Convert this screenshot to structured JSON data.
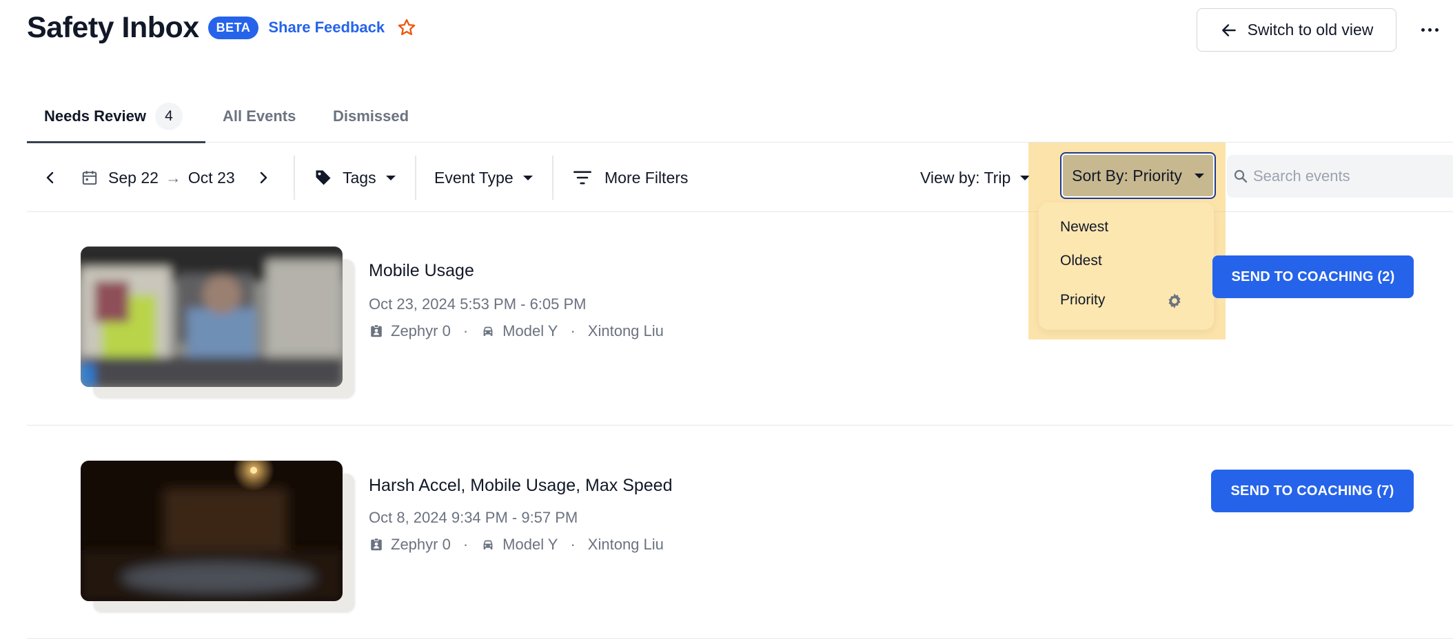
{
  "header": {
    "title": "Safety Inbox",
    "badge": "BETA",
    "feedback_link": "Share Feedback",
    "switch_button": "Switch to old view"
  },
  "tabs": [
    {
      "label": "Needs Review",
      "count": "4",
      "active": true
    },
    {
      "label": "All Events"
    },
    {
      "label": "Dismissed"
    }
  ],
  "filters": {
    "date_start": "Sep 22",
    "date_arrow": "→",
    "date_end": "Oct 23",
    "tags": "Tags",
    "event_type": "Event Type",
    "more_filters": "More Filters",
    "view_by": "View by: Trip",
    "sort_by": "Sort By: Priority",
    "search_placeholder": "Search events"
  },
  "sort_menu": {
    "options": [
      "Newest",
      "Oldest",
      "Priority"
    ],
    "selected": "Priority"
  },
  "events": [
    {
      "title": "Mobile Usage",
      "time": "Oct 23, 2024 5:53 PM - 6:05 PM",
      "driver": "Zephyr 0",
      "vehicle": "Model Y",
      "person": "Xintong Liu",
      "button": "SEND TO COACHING (2)"
    },
    {
      "title": "Harsh Accel, Mobile Usage, Max Speed",
      "time": "Oct 8, 2024 9:34 PM - 9:57 PM",
      "driver": "Zephyr 0",
      "vehicle": "Model Y",
      "person": "Xintong Liu",
      "button": "SEND TO COACHING (7)"
    }
  ],
  "meta_separator": "·",
  "colors": {
    "accent": "#2563eb",
    "star": "#ea580c",
    "highlight": "#facc64",
    "dropdown_bg": "#fde7b0"
  },
  "icons": [
    "star-icon",
    "arrow-left-icon",
    "more-icon",
    "chevron-left-icon",
    "calendar-icon",
    "chevron-right-icon",
    "tag-icon",
    "filter-icon",
    "search-icon",
    "gear-icon",
    "driver-badge-icon",
    "car-icon"
  ]
}
